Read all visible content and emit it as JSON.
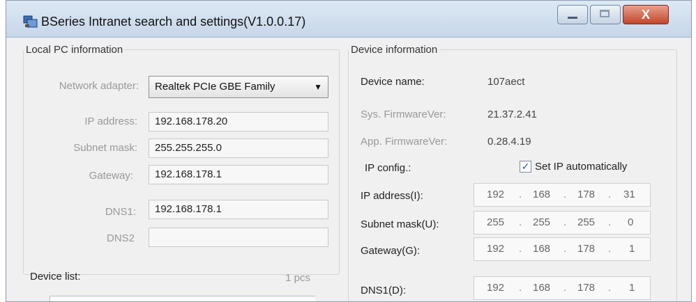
{
  "window": {
    "title": "BSeries Intranet search and settings(V1.0.0.17)",
    "close_label": "X"
  },
  "local": {
    "legend": "Local PC information",
    "adapter_label": "Network adapter:",
    "adapter_value": "Realtek PCIe GBE Family",
    "ip_label": "IP address:",
    "ip_value": "192.168.178.20",
    "mask_label": "Subnet mask:",
    "mask_value": "255.255.255.0",
    "gw_label": "Gateway:",
    "gw_value": "192.168.178.1",
    "dns1_label": "DNS1:",
    "dns1_value": "192.168.178.1",
    "dns2_label": "DNS2",
    "dns2_value": ""
  },
  "device_list": {
    "label": "Device list:",
    "count": "1 pcs"
  },
  "device": {
    "legend": "Device information",
    "name_label": "Device name:",
    "name_value": "107aect",
    "sysfw_label": "Sys. FirmwareVer:",
    "sysfw_value": "21.37.2.41",
    "appfw_label": "App. FirmwareVer:",
    "appfw_value": "0.28.4.19",
    "ipconfig_label": "IP config.:",
    "auto_label": "Set IP automatically",
    "auto_checked": true,
    "ip_label": "IP address(I):",
    "ip": [
      "192",
      "168",
      "178",
      "31"
    ],
    "mask_label": "Subnet mask(U):",
    "mask": [
      "255",
      "255",
      "255",
      "0"
    ],
    "gw_label": "Gateway(G):",
    "gw": [
      "192",
      "168",
      "178",
      "1"
    ],
    "dns_label": "DNS1(D):",
    "dns": [
      "192",
      "168",
      "178",
      "1"
    ]
  }
}
